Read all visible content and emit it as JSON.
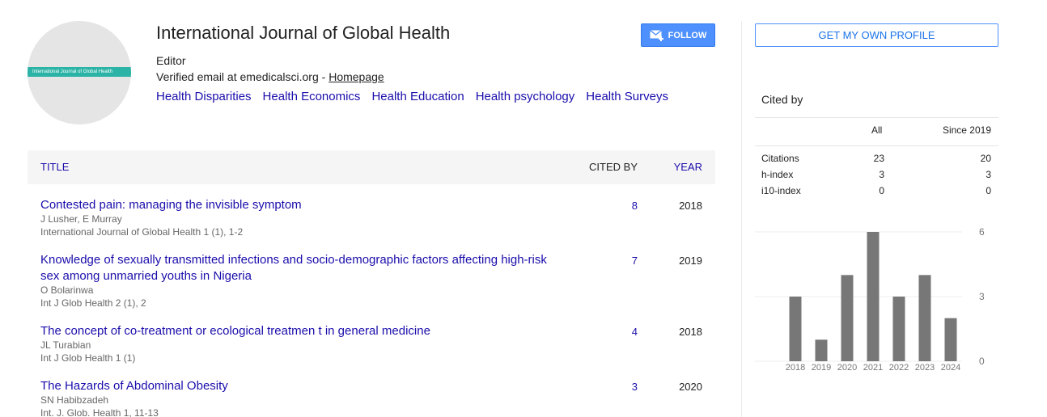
{
  "profile": {
    "avatar_text": "International Journal of Global Health",
    "name": "International Journal of Global Health",
    "affiliation": "Editor",
    "email_text": "Verified email at emedicalsci.org - ",
    "homepage_label": "Homepage",
    "interests": [
      "Health Disparities",
      "Health Economics",
      "Health Education",
      "Health psychology",
      "Health Surveys"
    ],
    "follow_label": "FOLLOW"
  },
  "articles_table": {
    "col_title": "TITLE",
    "col_cited": "CITED BY",
    "col_year": "YEAR",
    "rows": [
      {
        "title": "Contested pain: managing the invisible symptom",
        "authors": "J Lusher, E Murray",
        "venue": "International Journal of Global Health 1 (1), 1-2",
        "cited": "8",
        "year": "2018"
      },
      {
        "title": "Knowledge of sexually transmitted infections and socio-demographic factors affecting high-risk sex among unmarried youths in Nigeria",
        "authors": "O Bolarinwa",
        "venue": "Int J Glob Health 2 (1), 2",
        "cited": "7",
        "year": "2019"
      },
      {
        "title": "The concept of co-treatment or ecological treatmen t in general medicine",
        "authors": "JL Turabian",
        "venue": "Int J Glob Health 1 (1)",
        "cited": "4",
        "year": "2018"
      },
      {
        "title": "The Hazards of Abdominal Obesity",
        "authors": "SN Habibzadeh",
        "venue": "Int. J. Glob. Health 1, 11-13",
        "cited": "3",
        "year": "2020"
      }
    ]
  },
  "sidebar": {
    "own_profile_label": "GET MY OWN PROFILE",
    "cited_by_heading": "Cited by",
    "col_all": "All",
    "col_since": "Since 2019",
    "metrics": [
      {
        "label": "Citations",
        "all": "23",
        "since": "20"
      },
      {
        "label": "h-index",
        "all": "3",
        "since": "3"
      },
      {
        "label": "i10-index",
        "all": "0",
        "since": "0"
      }
    ]
  },
  "chart_data": {
    "type": "bar",
    "categories": [
      "2018",
      "2019",
      "2020",
      "2021",
      "2022",
      "2023",
      "2024"
    ],
    "values": [
      3,
      1,
      4,
      6,
      3,
      4,
      2
    ],
    "ylim": [
      0,
      6
    ],
    "yticks": [
      "0",
      "3",
      "6"
    ],
    "bar_color": "#777777"
  },
  "colors": {
    "link": "#1a0dab",
    "follow_bg": "#4d90fe",
    "avatar_band": "#2bb3a6"
  }
}
